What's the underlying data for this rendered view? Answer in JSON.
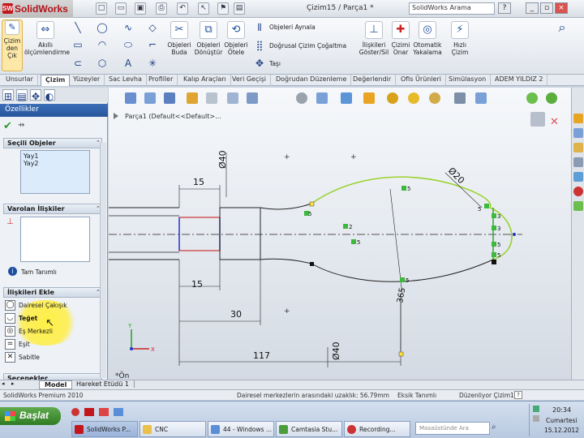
{
  "app": {
    "logo": "SolidWorks",
    "document_title": "Çizim15 / Parça1 *",
    "search_placeholder": "SolidWorks Arama"
  },
  "ribbon": {
    "sketch_button": "Çizim den Çık",
    "smart_dim": "Akıllı ölçümlendirme",
    "trim": "Objeleri Buda",
    "convert": "Objeleri Dönüştür",
    "offset": "Objeleri Ötele",
    "mirror": "Objeleri Aynala",
    "linear_pattern": "Doğrusal Çizim Çoğaltma",
    "move": "Taşı",
    "display_delete": "İlişkileri Göster/Sil",
    "repair": "Çizimi Onar",
    "quick_snaps": "Otomatik Yakalama",
    "rapid_sketch": "Hızlı Çizim"
  },
  "tabs": [
    "Unsurlar",
    "Çizim",
    "Yüzeyler",
    "Sac Levha",
    "Profiller",
    "Kalıp Araçları",
    "Veri Geçişi",
    "Doğrudan Düzenleme",
    "Değerlendir",
    "Ofis Ürünleri",
    "Simülasyon",
    "ADEM YILDIZ 2"
  ],
  "panel": {
    "title": "Özellikler",
    "selected_header": "Seçili Objeler",
    "selected_items": [
      "Yay1",
      "Yay2"
    ],
    "existing_header": "Varolan İlişkiler",
    "status": "Tam Tanımlı",
    "add_header": "İlişkileri Ekle",
    "relations": [
      "Dairesel Çakışık",
      "Teğet",
      "Eş Merkezli",
      "Eşit",
      "Sabitle"
    ],
    "options_header": "Seçenekler"
  },
  "canvas": {
    "tree_label": "Parça1  (Default<<Default>...",
    "view_label": "*Ön",
    "dims": [
      "15",
      "15",
      "30",
      "117",
      "Ø40",
      "Ø40",
      "Ø20",
      "365"
    ],
    "relation_labels": [
      "5",
      "5",
      "2",
      "5",
      "5",
      "3",
      "3",
      "5",
      "5",
      "5"
    ]
  },
  "bottom_tabs": [
    "Model",
    "Hareket Etüdü 1"
  ],
  "status": {
    "product": "SolidWorks Premium 2010",
    "message": "Dairesel merkezlerin arasındaki uzaklık: 56.79mm",
    "defined": "Eksik Tanımlı",
    "editing": "Düzenliyor Çizim15"
  },
  "taskbar": {
    "start": "Başlat",
    "buttons": [
      "SolidWorks P...",
      "CNC",
      "44 - Windows ...",
      "Camtasia Stu...",
      "Recording..."
    ],
    "search_placeholder": "Masaüstünde Ara",
    "time": "20:34",
    "day": "Cumartesi",
    "date": "15.12.2012"
  }
}
